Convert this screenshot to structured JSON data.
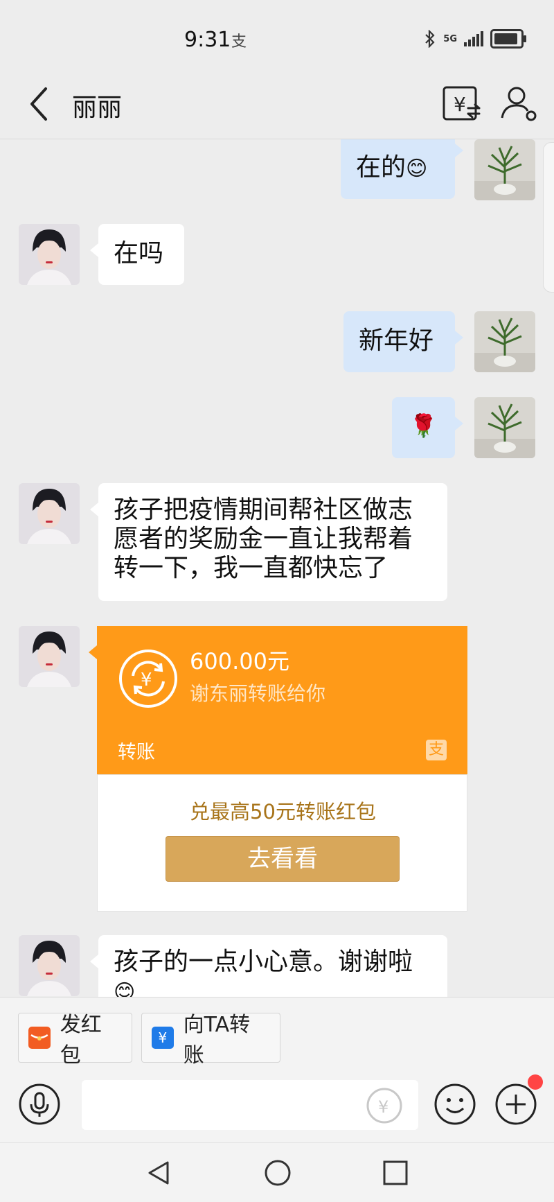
{
  "status_bar": {
    "time": "9:31",
    "alipay_glyph": "支",
    "network": "5G"
  },
  "header": {
    "title": "丽丽"
  },
  "messages": {
    "m1": {
      "text": "在的",
      "emoji": "😊"
    },
    "m2": {
      "text": "在吗"
    },
    "m3": {
      "text": "新年好"
    },
    "m4": {
      "emoji": "🌹"
    },
    "m5": {
      "text": "孩子把疫情期间帮社区做志愿者的奖励金一直让我帮着转一下，我一直都快忘了"
    },
    "m7": {
      "text": "孩子的一点小心意。谢谢啦",
      "emoji": "😊"
    }
  },
  "transfer_card": {
    "amount": "600.00元",
    "description": "谢东丽转账给你",
    "label": "转账",
    "alipay_glyph": "支",
    "promo_text": "兑最高50元转账红包",
    "button_label": "去看看",
    "accent_color": "#ff9a18"
  },
  "quick_actions": {
    "red_packet": {
      "label": "发红包",
      "icon": "red-packet-icon",
      "color": "#f25c22"
    },
    "transfer": {
      "label": "向TA转账",
      "icon": "transfer-icon",
      "color": "#1f7be8"
    }
  },
  "input": {
    "placeholder": ""
  }
}
